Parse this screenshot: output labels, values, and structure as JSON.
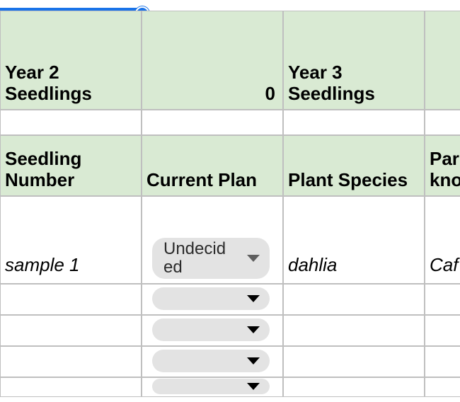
{
  "summary": {
    "year2": {
      "label": "Year 2 Seedlings",
      "value": "0"
    },
    "year3": {
      "label": "Year 3 Seedlings"
    }
  },
  "columns": {
    "seedling_number": "Seedling Number",
    "current_plan": "Current Plan",
    "plant_species": "Plant Species",
    "parent_partial": "Par kno"
  },
  "rows": [
    {
      "seedling_number": "sample 1",
      "current_plan": "Undecided",
      "plant_species": "dahlia",
      "parent_partial": "Caf"
    },
    {
      "current_plan": ""
    },
    {
      "current_plan": ""
    },
    {
      "current_plan": ""
    },
    {
      "current_plan": ""
    }
  ]
}
